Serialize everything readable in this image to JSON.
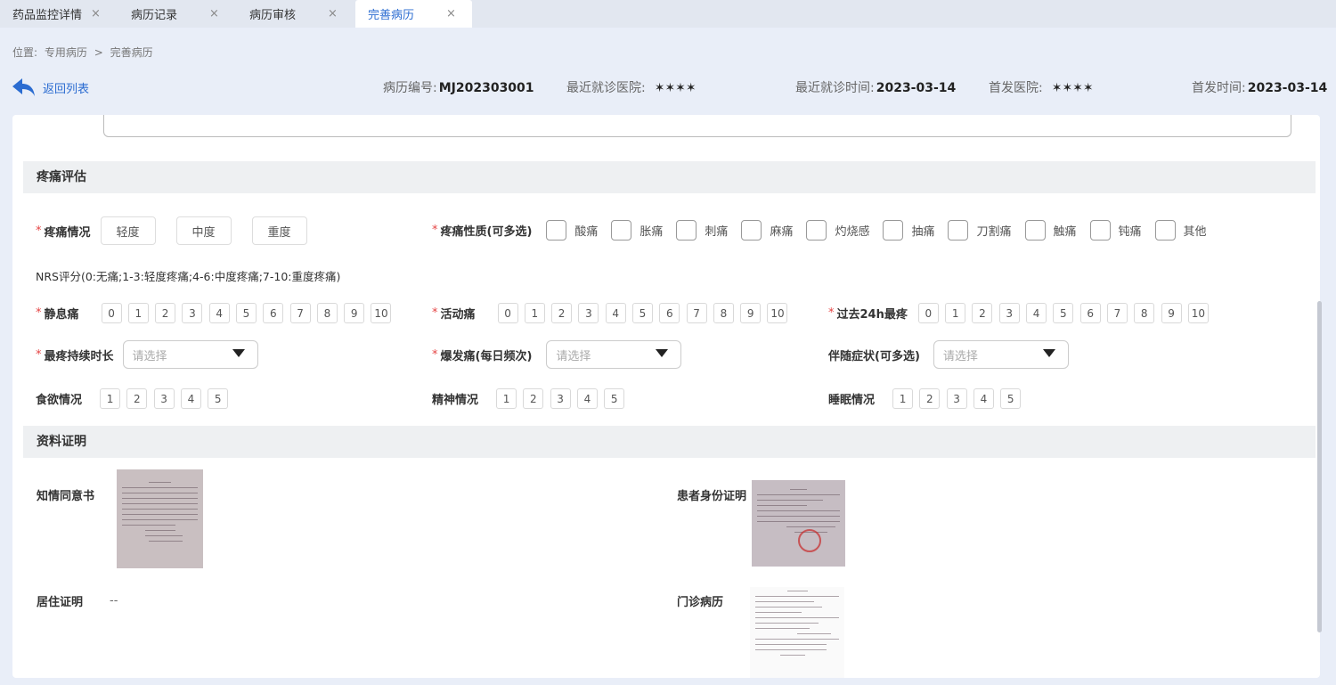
{
  "tabs": [
    {
      "label": "药品监控详情",
      "close": "×"
    },
    {
      "label": "病历记录",
      "close": "×"
    },
    {
      "label": "病历审核",
      "close": "×"
    },
    {
      "label": "完善病历",
      "close": "×"
    }
  ],
  "breadcrumb": {
    "prefix": "位置:",
    "parent": "专用病历",
    "sep": ">",
    "current": "完善病历"
  },
  "info": {
    "back_label": "返回列表",
    "record_no_label": "病历编号:",
    "record_no": "MJ202303001",
    "recent_hospital_label": "最近就诊医院:",
    "recent_hospital": "✶✶✶✶",
    "recent_time_label": "最近就诊时间:",
    "recent_time": "2023-03-14",
    "first_hospital_label": "首发医院:",
    "first_hospital": "✶✶✶✶",
    "first_time_label": "首发时间:",
    "first_time": "2023-03-14"
  },
  "pain": {
    "section_title": "疼痛评估",
    "required_mark": "*",
    "situation_label": "疼痛情况",
    "levels": [
      "轻度",
      "中度",
      "重度"
    ],
    "nature_label": "疼痛性质(可多选)",
    "natures": [
      "酸痛",
      "胀痛",
      "刺痛",
      "麻痛",
      "灼烧感",
      "抽痛",
      "刀割痛",
      "触痛",
      "钝痛",
      "其他"
    ],
    "nrs_note": "NRS评分(0:无痛;1-3:轻度疼痛;4-6:中度疼痛;7-10:重度疼痛)",
    "rest_label": "静息痛",
    "active_label": "活动痛",
    "past24_label": "过去24h最疼",
    "scale": [
      "0",
      "1",
      "2",
      "3",
      "4",
      "5",
      "6",
      "7",
      "8",
      "9",
      "10"
    ],
    "duration_label": "最疼持续时长",
    "breakthrough_label": "爆发痛(每日频次)",
    "symptom_label": "伴随症状(可多选)",
    "select_placeholder": "请选择",
    "appetite_label": "食欲情况",
    "spirit_label": "精神情况",
    "sleep_label": "睡眠情况",
    "five": [
      "1",
      "2",
      "3",
      "4",
      "5"
    ]
  },
  "docs": {
    "section_title": "资料证明",
    "consent_label": "知情同意书",
    "id_label": "患者身份证明",
    "residence_label": "居住证明",
    "residence_value": "--",
    "outpatient_label": "门诊病历"
  }
}
